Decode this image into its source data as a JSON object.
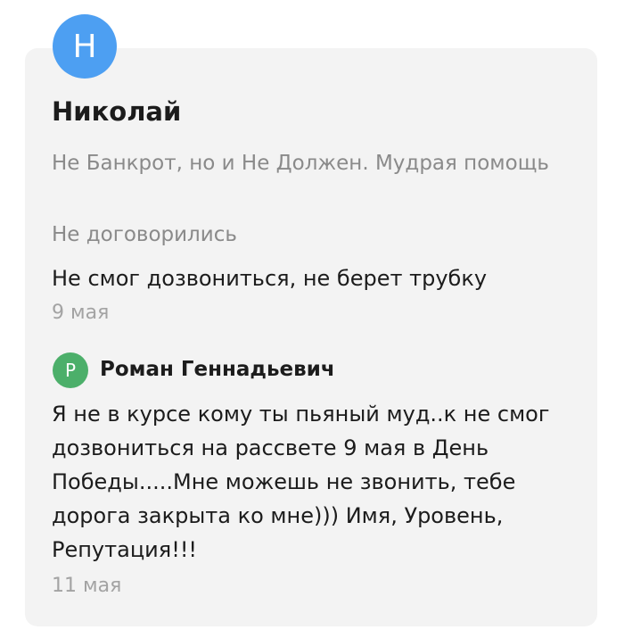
{
  "review": {
    "avatar_letter": "Н",
    "avatar_color": "#4d9ff2",
    "author": "Николай",
    "company": "Не Банкрот, но и Не Должен. Мудрая помощь",
    "status": "Не договорились",
    "text": "Не смог дозвониться, не берет трубку",
    "date": "9 мая"
  },
  "reply": {
    "avatar_letter": "Р",
    "avatar_color": "#4caf6a",
    "author": "Роман Геннадьевич",
    "text": "Я не в курсе кому ты пьяный муд..к не смог дозвониться на рассвете 9 мая в День Победы.....Мне можешь не звонить, тебе дорога закрыта ко мне))) Имя, Уровень, Репутация!!!",
    "date": "11 мая"
  }
}
